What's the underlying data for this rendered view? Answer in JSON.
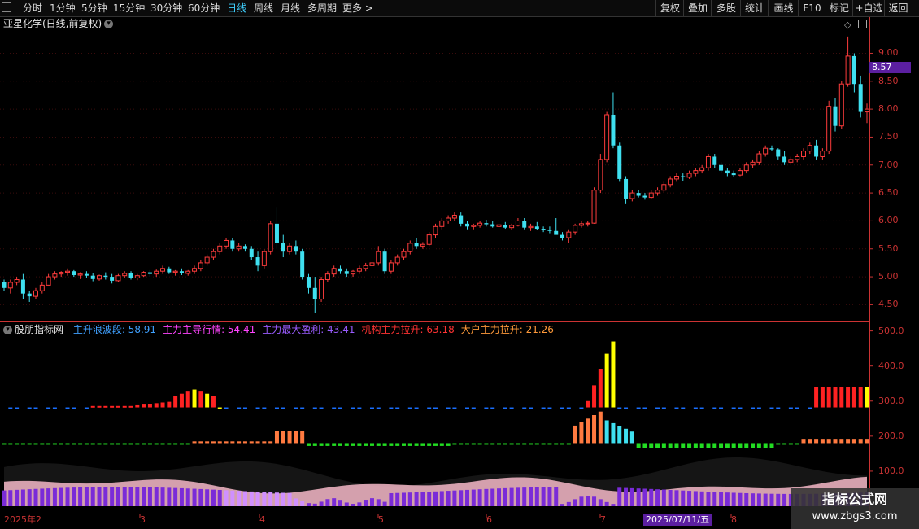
{
  "toolbar": {
    "periods": [
      "分时",
      "1分钟",
      "5分钟",
      "15分钟",
      "30分钟",
      "60分钟",
      "日线",
      "周线",
      "月线",
      "多周期",
      "更多 >"
    ],
    "active_period": "日线",
    "right_buttons": [
      "复权",
      "叠加",
      "多股",
      "统计",
      "画线",
      "F10",
      "标记",
      "+自选",
      "返回"
    ]
  },
  "stock": {
    "title": "亚星化学(日线,前复权)",
    "current_price": "8.57"
  },
  "price_axis": {
    "labels": [
      "9.00",
      "8.50",
      "8.00",
      "7.50",
      "7.00",
      "6.50",
      "6.00",
      "5.50",
      "5.00",
      "4.50"
    ]
  },
  "indicator": {
    "name": "股朋指标网",
    "items": [
      {
        "label": "主升浪波段: 58.91",
        "color": "#3fa0ff"
      },
      {
        "label": "主力主导行情: 54.41",
        "color": "#ff44ff"
      },
      {
        "label": "主力最大盈利: 43.41",
        "color": "#9a5cff"
      },
      {
        "label": "机构主力拉升: 63.18",
        "color": "#ff3333"
      },
      {
        "label": "大户主力拉升: 21.26",
        "color": "#ff9a3a"
      }
    ],
    "axis_labels": [
      "500.0",
      "400.0",
      "300.0",
      "200.0",
      "100.0"
    ]
  },
  "time_axis": {
    "labels": [
      "2025年2",
      "3",
      "4",
      "5",
      "6",
      "7",
      "8"
    ],
    "cursor_date": "2025/07/11/五"
  },
  "watermark": {
    "line1": "指标公式网",
    "line2": "www.zbgs3.com"
  },
  "colors": {
    "up": "#ff3c3c",
    "down": "#3fe0f0",
    "accent": "#5b1fa0",
    "axis": "#cc3333"
  },
  "chart_data": {
    "type": "candlestick",
    "y_range": [
      4.2,
      9.4
    ],
    "ohlc": [
      [
        4.9,
        4.95,
        4.75,
        4.8
      ],
      [
        4.8,
        4.95,
        4.7,
        4.9
      ],
      [
        4.9,
        5.0,
        4.85,
        4.95
      ],
      [
        4.95,
        5.05,
        4.6,
        4.7
      ],
      [
        4.7,
        4.75,
        4.55,
        4.65
      ],
      [
        4.65,
        4.8,
        4.6,
        4.75
      ],
      [
        4.75,
        4.9,
        4.7,
        4.85
      ],
      [
        4.85,
        5.05,
        4.85,
        5.0
      ],
      [
        5.0,
        5.1,
        4.95,
        5.05
      ],
      [
        5.05,
        5.1,
        5.0,
        5.08
      ],
      [
        5.08,
        5.15,
        5.02,
        5.1
      ],
      [
        5.1,
        5.12,
        5.0,
        5.03
      ],
      [
        5.03,
        5.08,
        4.96,
        5.05
      ],
      [
        5.05,
        5.1,
        4.98,
        5.02
      ],
      [
        5.02,
        5.06,
        4.92,
        4.96
      ],
      [
        4.96,
        5.04,
        4.93,
        5.02
      ],
      [
        5.02,
        5.08,
        4.95,
        5.0
      ],
      [
        5.0,
        5.05,
        4.88,
        4.93
      ],
      [
        4.93,
        5.05,
        4.9,
        5.02
      ],
      [
        5.02,
        5.1,
        4.98,
        5.06
      ],
      [
        5.06,
        5.1,
        4.95,
        4.98
      ],
      [
        4.98,
        5.05,
        4.94,
        5.02
      ],
      [
        5.02,
        5.1,
        5.0,
        5.08
      ],
      [
        5.08,
        5.12,
        5.0,
        5.05
      ],
      [
        5.05,
        5.13,
        5.0,
        5.1
      ],
      [
        5.1,
        5.2,
        5.05,
        5.15
      ],
      [
        5.15,
        5.18,
        5.05,
        5.08
      ],
      [
        5.08,
        5.12,
        5.02,
        5.1
      ],
      [
        5.1,
        5.15,
        5.03,
        5.06
      ],
      [
        5.06,
        5.12,
        5.02,
        5.1
      ],
      [
        5.1,
        5.2,
        5.05,
        5.15
      ],
      [
        5.15,
        5.3,
        5.1,
        5.25
      ],
      [
        5.25,
        5.4,
        5.2,
        5.35
      ],
      [
        5.35,
        5.5,
        5.3,
        5.45
      ],
      [
        5.45,
        5.6,
        5.4,
        5.55
      ],
      [
        5.55,
        5.7,
        5.5,
        5.65
      ],
      [
        5.65,
        5.7,
        5.45,
        5.5
      ],
      [
        5.5,
        5.6,
        5.45,
        5.55
      ],
      [
        5.55,
        5.58,
        5.45,
        5.5
      ],
      [
        5.5,
        5.55,
        5.3,
        5.35
      ],
      [
        5.35,
        5.45,
        5.1,
        5.2
      ],
      [
        5.2,
        5.5,
        5.15,
        5.45
      ],
      [
        5.45,
        6.0,
        5.4,
        5.95
      ],
      [
        5.95,
        6.25,
        5.5,
        5.6
      ],
      [
        5.6,
        5.75,
        5.35,
        5.45
      ],
      [
        5.45,
        5.6,
        5.4,
        5.55
      ],
      [
        5.55,
        5.65,
        5.4,
        5.45
      ],
      [
        5.45,
        5.5,
        4.95,
        5.0
      ],
      [
        5.0,
        5.05,
        4.7,
        4.8
      ],
      [
        4.8,
        5.0,
        4.35,
        4.6
      ],
      [
        4.6,
        5.0,
        4.55,
        4.95
      ],
      [
        4.95,
        5.1,
        4.9,
        5.05
      ],
      [
        5.05,
        5.2,
        5.0,
        5.15
      ],
      [
        5.15,
        5.2,
        5.05,
        5.1
      ],
      [
        5.1,
        5.15,
        5.0,
        5.05
      ],
      [
        5.05,
        5.12,
        5.0,
        5.1
      ],
      [
        5.1,
        5.2,
        5.05,
        5.15
      ],
      [
        5.15,
        5.25,
        5.1,
        5.2
      ],
      [
        5.2,
        5.3,
        5.15,
        5.25
      ],
      [
        5.25,
        5.55,
        5.2,
        5.45
      ],
      [
        5.45,
        5.5,
        5.05,
        5.1
      ],
      [
        5.1,
        5.3,
        5.05,
        5.25
      ],
      [
        5.25,
        5.4,
        5.2,
        5.35
      ],
      [
        5.35,
        5.5,
        5.3,
        5.45
      ],
      [
        5.45,
        5.65,
        5.4,
        5.6
      ],
      [
        5.6,
        5.7,
        5.5,
        5.55
      ],
      [
        5.55,
        5.62,
        5.5,
        5.58
      ],
      [
        5.58,
        5.8,
        5.55,
        5.75
      ],
      [
        5.75,
        5.95,
        5.7,
        5.9
      ],
      [
        5.9,
        6.05,
        5.85,
        6.0
      ],
      [
        6.0,
        6.1,
        5.95,
        6.05
      ],
      [
        6.05,
        6.15,
        6.0,
        6.1
      ],
      [
        6.1,
        6.15,
        5.9,
        5.95
      ],
      [
        5.95,
        6.0,
        5.85,
        5.9
      ],
      [
        5.9,
        5.95,
        5.85,
        5.92
      ],
      [
        5.92,
        6.0,
        5.88,
        5.96
      ],
      [
        5.96,
        6.02,
        5.9,
        5.94
      ],
      [
        5.94,
        6.0,
        5.88,
        5.9
      ],
      [
        5.9,
        5.96,
        5.85,
        5.93
      ],
      [
        5.93,
        5.98,
        5.86,
        5.88
      ],
      [
        5.88,
        5.95,
        5.84,
        5.92
      ],
      [
        5.92,
        6.05,
        5.9,
        6.0
      ],
      [
        6.0,
        6.05,
        5.85,
        5.88
      ],
      [
        5.88,
        5.95,
        5.82,
        5.9
      ],
      [
        5.9,
        5.98,
        5.84,
        5.86
      ],
      [
        5.86,
        5.9,
        5.8,
        5.84
      ],
      [
        5.84,
        5.9,
        5.78,
        5.82
      ],
      [
        5.82,
        6.05,
        5.8,
        5.75
      ],
      [
        5.75,
        5.8,
        5.65,
        5.7
      ],
      [
        5.7,
        5.85,
        5.6,
        5.8
      ],
      [
        5.8,
        5.95,
        5.75,
        5.92
      ],
      [
        5.92,
        6.0,
        5.88,
        5.95
      ],
      [
        5.95,
        6.0,
        5.9,
        5.96
      ],
      [
        5.96,
        6.6,
        5.95,
        6.55
      ],
      [
        6.55,
        7.2,
        6.5,
        7.1
      ],
      [
        7.1,
        7.95,
        7.05,
        7.9
      ],
      [
        7.9,
        8.3,
        7.3,
        7.35
      ],
      [
        7.35,
        7.4,
        6.7,
        6.75
      ],
      [
        6.75,
        6.8,
        6.3,
        6.4
      ],
      [
        6.4,
        6.55,
        6.35,
        6.5
      ],
      [
        6.5,
        6.55,
        6.42,
        6.45
      ],
      [
        6.45,
        6.5,
        6.38,
        6.42
      ],
      [
        6.42,
        6.55,
        6.4,
        6.5
      ],
      [
        6.5,
        6.6,
        6.45,
        6.55
      ],
      [
        6.55,
        6.7,
        6.5,
        6.65
      ],
      [
        6.65,
        6.8,
        6.6,
        6.75
      ],
      [
        6.75,
        6.85,
        6.7,
        6.8
      ],
      [
        6.8,
        6.85,
        6.72,
        6.78
      ],
      [
        6.78,
        6.9,
        6.75,
        6.85
      ],
      [
        6.85,
        6.95,
        6.8,
        6.9
      ],
      [
        6.9,
        7.0,
        6.85,
        6.95
      ],
      [
        6.95,
        7.2,
        6.9,
        7.15
      ],
      [
        7.15,
        7.2,
        6.95,
        7.0
      ],
      [
        7.0,
        7.05,
        6.85,
        6.9
      ],
      [
        6.9,
        6.95,
        6.8,
        6.85
      ],
      [
        6.85,
        6.9,
        6.78,
        6.82
      ],
      [
        6.82,
        6.95,
        6.8,
        6.9
      ],
      [
        6.9,
        7.05,
        6.85,
        7.0
      ],
      [
        7.0,
        7.1,
        6.95,
        7.05
      ],
      [
        7.05,
        7.25,
        7.0,
        7.2
      ],
      [
        7.2,
        7.35,
        7.15,
        7.3
      ],
      [
        7.3,
        7.35,
        7.25,
        7.28
      ],
      [
        7.28,
        7.3,
        7.1,
        7.15
      ],
      [
        7.15,
        7.25,
        7.0,
        7.05
      ],
      [
        7.05,
        7.15,
        7.0,
        7.1
      ],
      [
        7.1,
        7.2,
        7.05,
        7.15
      ],
      [
        7.15,
        7.3,
        7.1,
        7.25
      ],
      [
        7.25,
        7.4,
        7.2,
        7.35
      ],
      [
        7.35,
        7.45,
        7.1,
        7.15
      ],
      [
        7.15,
        7.3,
        7.1,
        7.25
      ],
      [
        7.25,
        8.15,
        7.2,
        8.05
      ],
      [
        8.05,
        8.2,
        7.6,
        7.7
      ],
      [
        7.7,
        8.5,
        7.65,
        8.45
      ],
      [
        8.45,
        9.3,
        8.4,
        8.95
      ],
      [
        8.95,
        9.0,
        8.3,
        8.45
      ],
      [
        8.45,
        8.6,
        7.85,
        7.95
      ],
      [
        7.95,
        8.1,
        7.75,
        8.0
      ]
    ],
    "indicator_y_range": [
      0,
      520
    ],
    "upper_bars": [
      {
        "start": 0,
        "end": 10,
        "value": 280,
        "color": "#1a6fff"
      },
      {
        "start": 11,
        "end": 26,
        "value": 285,
        "color": "#ff2222"
      },
      {
        "start": 27,
        "end": 33,
        "value": 330,
        "color": "#ff2222"
      },
      {
        "start": 34,
        "end": 39,
        "value": 300,
        "color": "#ffff00"
      }
    ]
  }
}
